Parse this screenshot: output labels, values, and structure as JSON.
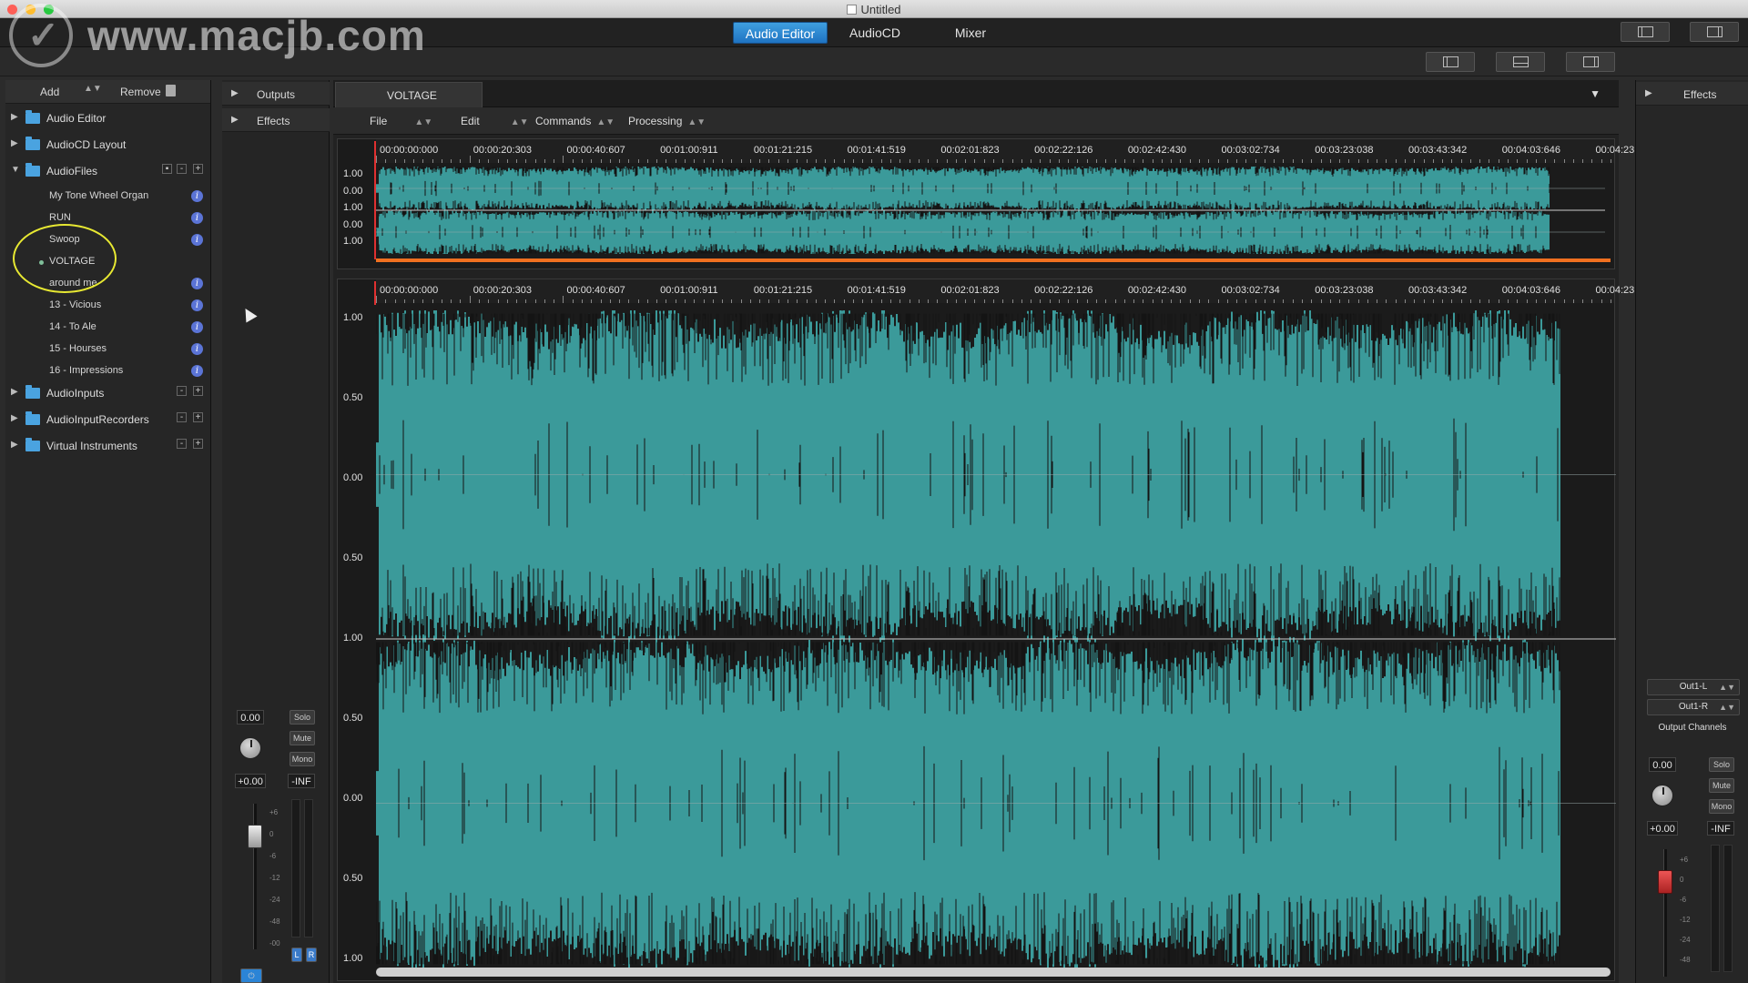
{
  "window": {
    "title": "Untitled",
    "traffic_colors": [
      "#fd5f57",
      "#febc2e",
      "#28c840"
    ]
  },
  "watermark": {
    "text": "www.macjb.com"
  },
  "toolbar": {
    "tabs": [
      {
        "label": "Audio Editor",
        "active": true
      },
      {
        "label": "AudioCD",
        "active": false
      },
      {
        "label": "Mixer",
        "active": false
      }
    ]
  },
  "left_panel": {
    "add_label": "Add",
    "remove_label": "Remove",
    "tree": [
      {
        "label": "Audio Editor",
        "expanded": false
      },
      {
        "label": "AudioCD Layout",
        "expanded": false
      },
      {
        "label": "AudioFiles",
        "expanded": true
      }
    ],
    "files": [
      {
        "label": "My Tone Wheel Organ",
        "info": true
      },
      {
        "label": "RUN",
        "info": true
      },
      {
        "label": "Swoop",
        "info": true
      },
      {
        "label": "VOLTAGE",
        "info": false,
        "selected": true
      },
      {
        "label": "around me",
        "info": true
      },
      {
        "label": "13 - Vicious",
        "info": true
      },
      {
        "label": "14 - To Ale",
        "info": true
      },
      {
        "label": "15 - Hourses",
        "info": true
      },
      {
        "label": "16 - Impressions",
        "info": true
      }
    ],
    "tree_bottom": [
      {
        "label": "AudioInputs"
      },
      {
        "label": "AudioInputRecorders"
      },
      {
        "label": "Virtual Instruments"
      }
    ],
    "highlight_color": "#e7e832"
  },
  "mid_panel": {
    "outputs_label": "Outputs",
    "effects_label": "Effects",
    "strip": {
      "value": "0.00",
      "solo": "Solo",
      "mute": "Mute",
      "mono": "Mono",
      "gain": "+0.00",
      "peak": "-INF",
      "scale": [
        "+6",
        "0",
        "-6",
        "-12",
        "-24",
        "-48",
        "-00"
      ],
      "l": "L",
      "r": "R"
    }
  },
  "editor": {
    "tab_label": "VOLTAGE",
    "menus": [
      "File",
      "Edit",
      "Commands",
      "Processing"
    ],
    "ruler_labels": [
      "00:00:00:000",
      "00:00:20:303",
      "00:00:40:607",
      "00:01:00:911",
      "00:01:21:215",
      "00:01:41:519",
      "00:02:01:823",
      "00:02:22:126",
      "00:02:42:430",
      "00:03:02:734",
      "00:03:23:038",
      "00:03:43:342",
      "00:04:03:646",
      "00:04:23:9"
    ],
    "overview_amp": [
      "1.00",
      "0.00",
      "1.00",
      "0.00",
      "1.00"
    ],
    "main_amp": [
      "1.00",
      "0.50",
      "0.00",
      "0.50",
      "1.00",
      "0.50",
      "0.00",
      "0.50",
      "1.00"
    ],
    "wave_color": "#3b9a9a",
    "highlight_bar_color": "#f07020"
  },
  "right_panel": {
    "effects_label": "Effects",
    "out_left": "Out1-L",
    "out_right": "Out1-R",
    "output_channels": "Output Channels",
    "strip": {
      "value": "0.00",
      "solo": "Solo",
      "mute": "Mute",
      "mono": "Mono",
      "gain": "+0.00",
      "peak": "-INF",
      "scale": [
        "+6",
        "0",
        "-6",
        "-12",
        "-24",
        "-48"
      ]
    },
    "fader_color": "#d23a3a"
  }
}
